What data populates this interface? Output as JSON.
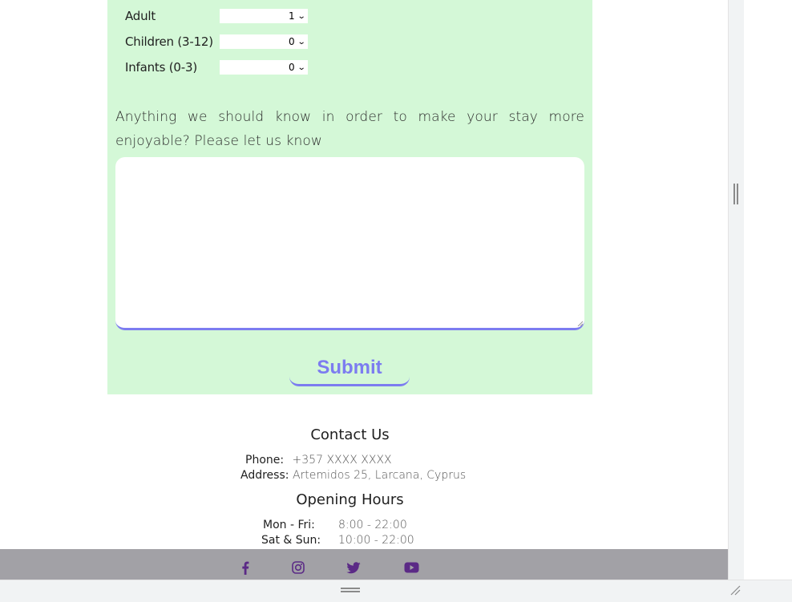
{
  "guests": [
    {
      "label": "Adult",
      "value": "1"
    },
    {
      "label": "Children (3-12)",
      "value": "0"
    },
    {
      "label": "Infants (0-3)",
      "value": "0"
    }
  ],
  "notes": {
    "prompt": "Anything we should know in order to make your stay more enjoyable? Please let us know",
    "value": ""
  },
  "submit_label": "Submit",
  "contact": {
    "title": "Contact Us",
    "phone_label": "Phone:",
    "phone_value": "+357 XXXX XXXX",
    "address_label": "Address:",
    "address_value": "Artemidos 25, Larcana, Cyprus"
  },
  "hours": {
    "title": "Opening Hours",
    "rows": [
      {
        "days": "Mon - Fri:",
        "time": "8:00 - 22:00"
      },
      {
        "days": "Sat & Sun:",
        "time": "10:00 - 22:00"
      }
    ]
  },
  "social": {
    "icons": [
      "facebook-icon",
      "instagram-icon",
      "twitter-icon",
      "youtube-icon"
    ],
    "color": "#5b2a86"
  },
  "colors": {
    "panel_bg": "#d4f8d7",
    "accent": "#7c7cf0",
    "footer_bg": "#a2a1a6"
  }
}
